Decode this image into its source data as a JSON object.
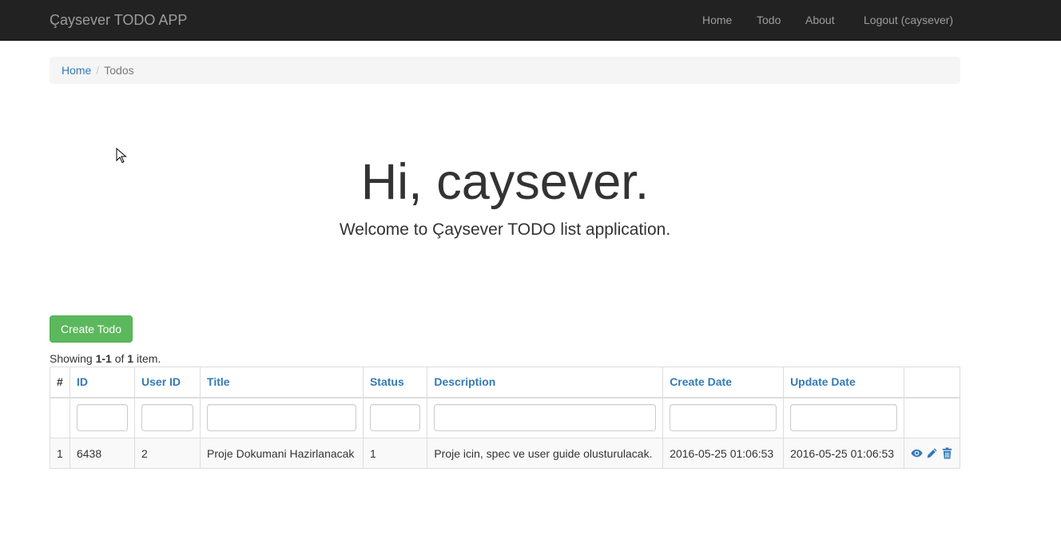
{
  "navbar": {
    "brand": "Çaysever TODO APP",
    "links": [
      "Home",
      "Todo",
      "About",
      "Logout (caysever)"
    ]
  },
  "breadcrumb": {
    "home": "Home",
    "separator": "/",
    "current": "Todos"
  },
  "jumbotron": {
    "title": "Hi, caysever.",
    "lead": "Welcome to Çaysever TODO list application."
  },
  "create_button": "Create Todo",
  "summary": {
    "prefix": "Showing ",
    "range": "1-1",
    "middle": " of ",
    "total": "1",
    "suffix": " item."
  },
  "table": {
    "columns": [
      "#",
      "ID",
      "User ID",
      "Title",
      "Status",
      "Description",
      "Create Date",
      "Update Date"
    ],
    "rows": [
      {
        "num": "1",
        "id": "6438",
        "user_id": "2",
        "title": "Proje Dokumani Hazirlanacak",
        "status": "1",
        "description": "Proje icin, spec ve user guide olusturulacak.",
        "create_date": "2016-05-25 01:06:53",
        "update_date": "2016-05-25 01:06:53",
        "actions": [
          "eye-icon",
          "pencil-icon",
          "trash-icon"
        ]
      }
    ]
  },
  "colors": {
    "navbar_bg": "#222222",
    "nav_text": "#9d9d9d",
    "link": "#337ab7",
    "success": "#5cb85c",
    "breadcrumb_bg": "#f5f5f5"
  }
}
